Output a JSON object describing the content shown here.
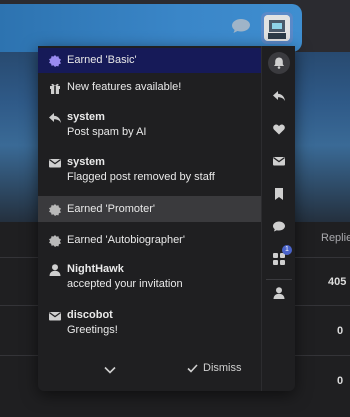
{
  "notifications": [
    {
      "icon": "badge-icon",
      "title": "",
      "text": "Earned 'Basic'",
      "state": "highlight"
    },
    {
      "icon": "gift-icon",
      "title": "",
      "text": "New features available!",
      "state": "normal"
    },
    {
      "icon": "reply-icon",
      "title": "system",
      "text": "Post spam by AI",
      "state": "normal"
    },
    {
      "icon": "envelope-icon",
      "title": "system",
      "text": "Flagged post removed by staff",
      "state": "normal"
    },
    {
      "icon": "badge-icon",
      "title": "",
      "text": "Earned 'Promoter'",
      "state": "selected"
    },
    {
      "icon": "badge-icon",
      "title": "",
      "text": "Earned 'Autobiographer'",
      "state": "normal"
    },
    {
      "icon": "user-icon",
      "title": "NightHawk",
      "text": "accepted your invitation",
      "state": "normal"
    },
    {
      "icon": "envelope-icon",
      "title": "discobot",
      "text": "Greetings!",
      "state": "normal"
    }
  ],
  "footer": {
    "dismiss_label": "Dismiss"
  },
  "tabs": [
    {
      "icon": "bell-icon",
      "active": true
    },
    {
      "icon": "reply-icon"
    },
    {
      "icon": "heart-icon"
    },
    {
      "icon": "envelope-icon"
    },
    {
      "icon": "bookmark-icon"
    },
    {
      "icon": "chat-icon"
    },
    {
      "icon": "apps-icon",
      "badge": "1"
    },
    {
      "icon": "user-icon"
    }
  ],
  "background": {
    "column_header": "Replie",
    "row_values": [
      "405",
      "0",
      "0"
    ]
  },
  "colors": {
    "highlight": "#161a58",
    "selected": "#3a3a3d",
    "badge_blue": "#4a63c9",
    "header_blue": "#3a86c8"
  }
}
